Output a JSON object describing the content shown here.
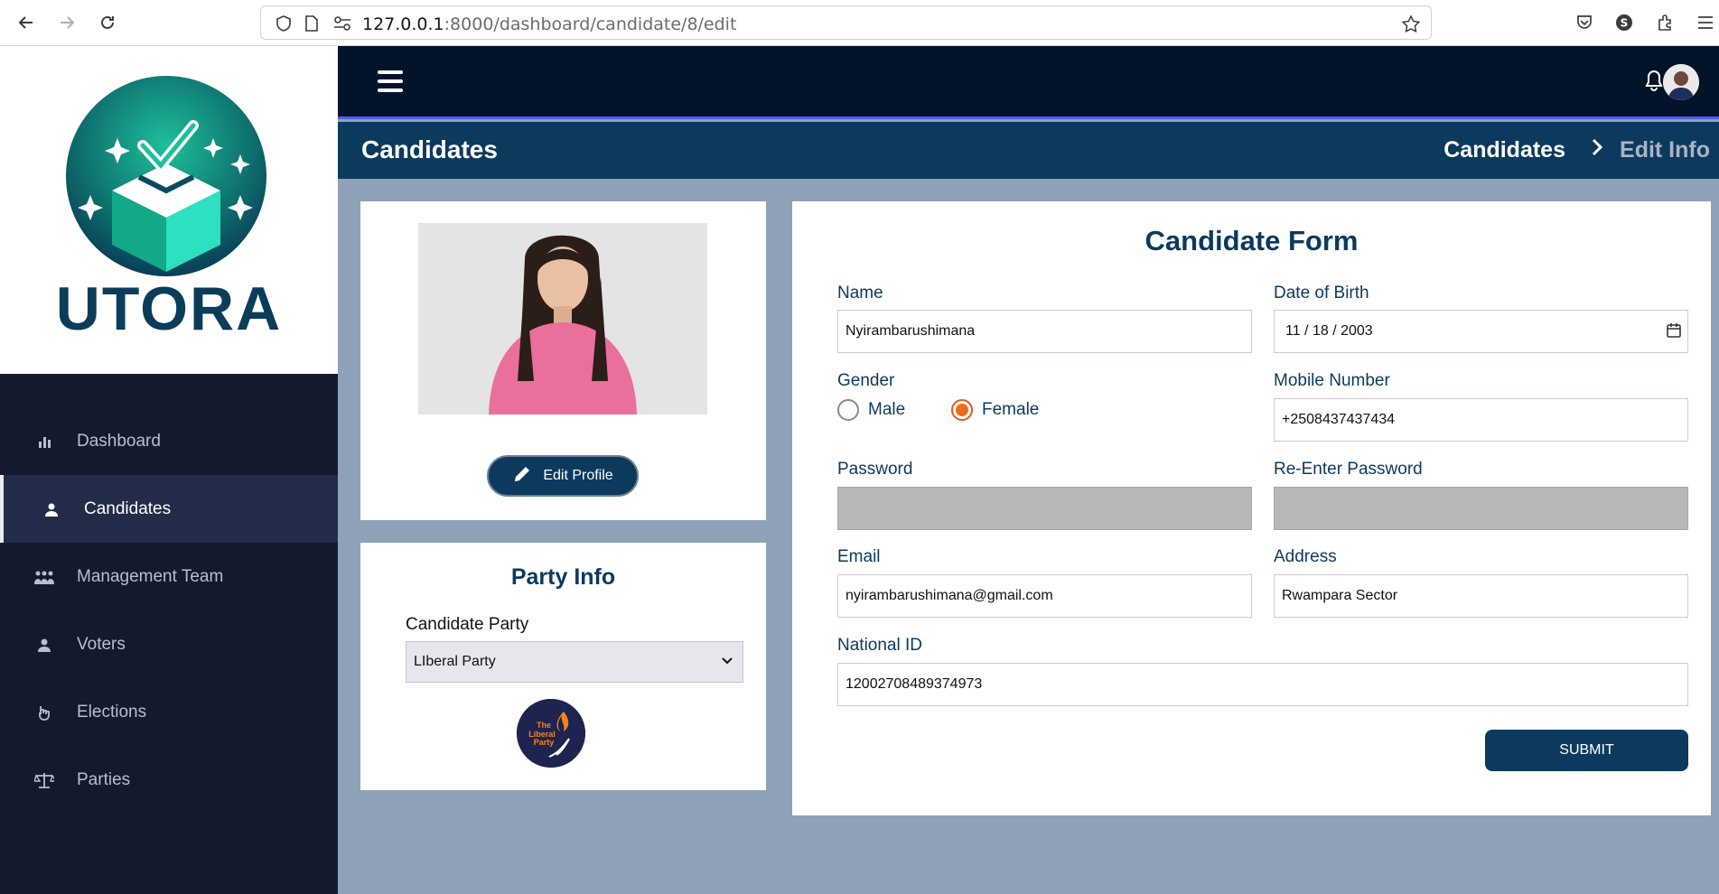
{
  "browser": {
    "url_host": "127.0.0.1",
    "url_path": ":8000/dashboard/candidate/8/edit"
  },
  "brand": {
    "name": "UTORA"
  },
  "sidebar": {
    "items": [
      {
        "label": "Dashboard",
        "icon": "bar-chart-icon",
        "active": false
      },
      {
        "label": "Candidates",
        "icon": "user-icon",
        "active": true
      },
      {
        "label": "Management Team",
        "icon": "team-icon",
        "active": false
      },
      {
        "label": "Voters",
        "icon": "user-icon",
        "active": false
      },
      {
        "label": "Elections",
        "icon": "hand-vote-icon",
        "active": false
      },
      {
        "label": "Parties",
        "icon": "scale-icon",
        "active": false
      }
    ]
  },
  "header": {
    "title": "Candidates",
    "breadcrumb": [
      "Candidates",
      "Edit Info"
    ]
  },
  "profile": {
    "edit_label": "Edit Profile"
  },
  "party": {
    "title": "Party Info",
    "label": "Candidate Party",
    "selected": "LIberal Party",
    "logo_text": [
      "The",
      "Liberal",
      "Party"
    ]
  },
  "form": {
    "title": "Candidate Form",
    "name_label": "Name",
    "name_value": "Nyirambarushimana",
    "dob_label": "Date of Birth",
    "dob_value": "11 / 18 / 2003",
    "gender_label": "Gender",
    "gender_options": [
      "Male",
      "Female"
    ],
    "gender_selected": "Female",
    "mobile_label": "Mobile Number",
    "mobile_value": "+2508437437434",
    "password_label": "Password",
    "repassword_label": "Re-Enter Password",
    "email_label": "Email",
    "email_value": "nyirambarushimana@gmail.com",
    "address_label": "Address",
    "address_value": "Rwampara Sector",
    "nid_label": "National ID",
    "nid_value": "12002708489374973",
    "submit_label": "SUBMIT"
  },
  "colors": {
    "primary": "#0b3a5d",
    "sidebar_bg": "#131a2e",
    "accent_radio": "#f26b21",
    "page_bg": "#8fa1b8"
  }
}
